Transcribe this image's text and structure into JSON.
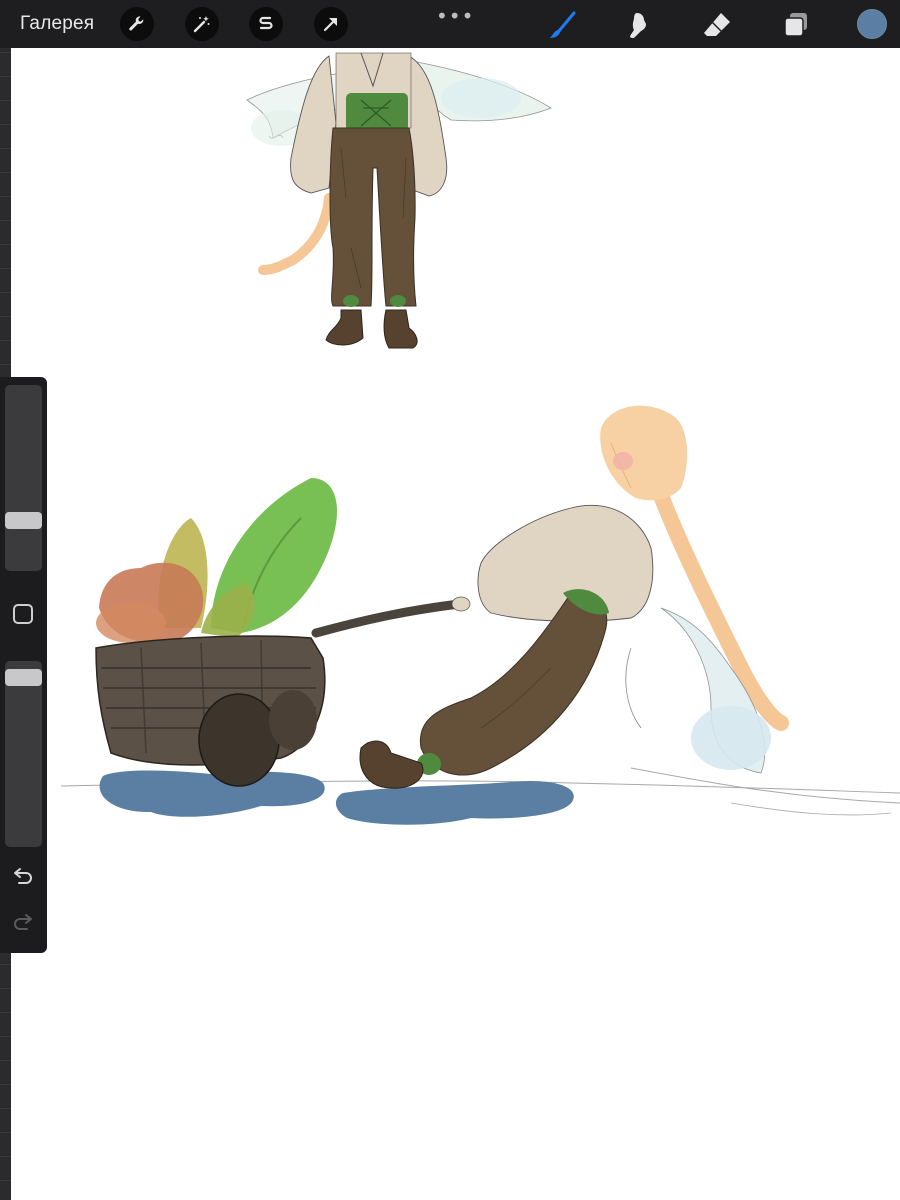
{
  "toolbar": {
    "gallery_label": "Галерея",
    "more_label": "•••",
    "left_tools": [
      {
        "name": "actions",
        "icon": "wrench-icon"
      },
      {
        "name": "adjustments",
        "icon": "magic-wand-icon"
      },
      {
        "name": "selection",
        "icon": "selection-s-icon"
      },
      {
        "name": "transform",
        "icon": "arrow-cursor-icon"
      }
    ],
    "right_tools": [
      {
        "name": "brush",
        "icon": "brush-icon",
        "active": true
      },
      {
        "name": "smudge",
        "icon": "smudge-finger-icon"
      },
      {
        "name": "eraser",
        "icon": "eraser-icon"
      },
      {
        "name": "layers",
        "icon": "layers-icon"
      }
    ],
    "current_color": "#5b7ea3",
    "accent_color": "#1d7cf2"
  },
  "sidebar": {
    "brush_size_level": 0.25,
    "opacity_level": 0.95,
    "modify_icon": "square-icon",
    "undo_icon": "undo-arrow-icon",
    "redo_icon": "redo-arrow-icon"
  },
  "canvas": {
    "content": "drawing"
  }
}
